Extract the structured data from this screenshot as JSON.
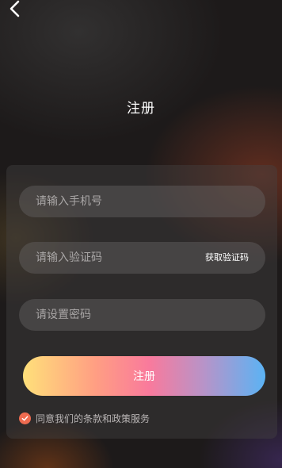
{
  "header": {
    "back_icon": "chevron-left-icon",
    "title": "注册"
  },
  "form": {
    "phone_placeholder": "请输入手机号",
    "phone_value": "",
    "code_placeholder": "请输入验证码",
    "code_value": "",
    "get_code_label": "获取验证码",
    "password_placeholder": "请设置密码",
    "password_value": "",
    "submit_label": "注册"
  },
  "agreement": {
    "checked": true,
    "check_icon": "checkmark-icon",
    "text": "同意我们的条款和政策服务"
  },
  "colors": {
    "accent": "#ee6b50",
    "button_gradient": [
      "#ffe07a",
      "#f97a9c",
      "#5bb3f4"
    ]
  }
}
